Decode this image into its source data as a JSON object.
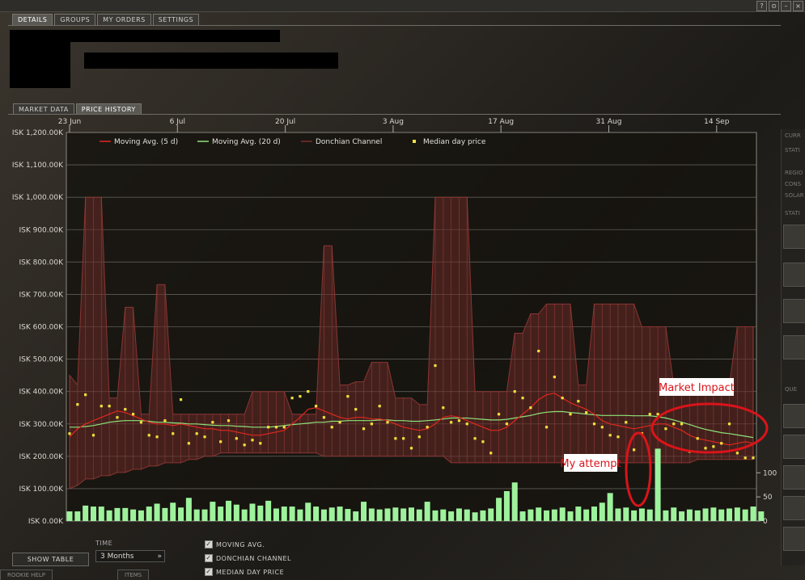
{
  "window": {
    "controls": [
      "?",
      "⊙",
      "–",
      "×"
    ]
  },
  "main_tabs": [
    {
      "label": "DETAILS",
      "active": true
    },
    {
      "label": "GROUPS",
      "active": false
    },
    {
      "label": "MY ORDERS",
      "active": false
    },
    {
      "label": "SETTINGS",
      "active": false
    }
  ],
  "sub_tabs": [
    {
      "label": "MARKET DATA",
      "active": false
    },
    {
      "label": "PRICE HISTORY",
      "active": true
    }
  ],
  "chart_data": {
    "type": "line",
    "x_ticks": [
      "23 Jun",
      "6 Jul",
      "20 Jul",
      "3 Aug",
      "17 Aug",
      "31 Aug",
      "14 Sep"
    ],
    "y_ticks": [
      "ISK 1,200.00K",
      "ISK 1,100.00K",
      "ISK 1,000.00K",
      "ISK 900.00K",
      "ISK 800.00K",
      "ISK 700.00K",
      "ISK 600.00K",
      "ISK 500.00K",
      "ISK 400.00K",
      "ISK 300.00K",
      "ISK 200.00K",
      "ISK 100.00K",
      "ISK 0.00K"
    ],
    "ylim": [
      0,
      1200
    ],
    "volume_ticks": [
      "100",
      "50",
      "0"
    ],
    "volume_lim": [
      0,
      150
    ],
    "legend": [
      {
        "label": "Moving Avg. (5 d)",
        "color": "#e0281f",
        "kind": "line"
      },
      {
        "label": "Moving Avg. (20 d)",
        "color": "#8ee37a",
        "kind": "line"
      },
      {
        "label": "Donchian Channel",
        "color": "#7a2c2a",
        "kind": "line"
      },
      {
        "label": "Median day price",
        "color": "#f2e23b",
        "kind": "point"
      }
    ],
    "series": [
      {
        "name": "Median day price",
        "values": [
          270,
          360,
          390,
          265,
          355,
          355,
          320,
          345,
          330,
          305,
          265,
          260,
          310,
          270,
          375,
          240,
          270,
          260,
          305,
          245,
          310,
          255,
          235,
          250,
          240,
          290,
          290,
          290,
          380,
          385,
          400,
          355,
          320,
          290,
          305,
          385,
          345,
          285,
          300,
          355,
          305,
          255,
          255,
          225,
          260,
          290,
          480,
          350,
          305,
          310,
          300,
          255,
          245,
          210,
          330,
          300,
          400,
          380,
          350,
          525,
          290,
          445,
          380,
          330,
          370,
          335,
          300,
          290,
          265,
          260,
          305,
          220,
          270,
          330,
          330,
          285,
          300,
          300,
          215,
          255,
          225,
          230,
          240,
          300,
          210,
          195,
          195
        ]
      },
      {
        "name": "Moving Avg. (5 d)",
        "values": [
          260,
          285,
          300,
          310,
          320,
          330,
          340,
          335,
          325,
          315,
          305,
          300,
          300,
          295,
          300,
          295,
          290,
          285,
          285,
          280,
          280,
          275,
          270,
          265,
          265,
          270,
          275,
          280,
          300,
          320,
          345,
          350,
          340,
          330,
          320,
          315,
          320,
          320,
          315,
          315,
          310,
          300,
          290,
          285,
          280,
          285,
          300,
          320,
          325,
          320,
          310,
          300,
          290,
          280,
          280,
          290,
          310,
          330,
          350,
          375,
          390,
          395,
          380,
          365,
          355,
          345,
          330,
          310,
          300,
          295,
          290,
          285,
          290,
          295,
          300,
          300,
          290,
          280,
          265,
          255,
          250,
          245,
          240,
          235,
          240,
          245,
          240
        ]
      },
      {
        "name": "Moving Avg. (20 d)",
        "values": [
          290,
          290,
          292,
          295,
          300,
          305,
          308,
          310,
          310,
          310,
          308,
          305,
          305,
          303,
          302,
          300,
          300,
          298,
          296,
          295,
          295,
          293,
          292,
          290,
          290,
          290,
          292,
          295,
          298,
          300,
          302,
          305,
          305,
          308,
          308,
          310,
          310,
          310,
          310,
          312,
          312,
          310,
          310,
          308,
          308,
          310,
          312,
          315,
          318,
          318,
          318,
          316,
          314,
          312,
          312,
          314,
          318,
          322,
          326,
          332,
          336,
          338,
          338,
          335,
          333,
          330,
          328,
          326,
          326,
          326,
          326,
          325,
          325,
          325,
          322,
          318,
          312,
          305,
          298,
          290,
          283,
          278,
          273,
          270,
          266,
          262,
          258
        ]
      },
      {
        "name": "Donchian Channel",
        "high": [
          450,
          420,
          1000,
          1000,
          1000,
          380,
          380,
          660,
          660,
          330,
          330,
          730,
          730,
          330,
          330,
          330,
          330,
          330,
          330,
          330,
          330,
          330,
          330,
          400,
          400,
          400,
          400,
          400,
          330,
          330,
          330,
          330,
          850,
          850,
          420,
          420,
          430,
          430,
          490,
          490,
          490,
          380,
          380,
          380,
          360,
          360,
          1000,
          1000,
          1000,
          1000,
          1000,
          400,
          400,
          400,
          400,
          400,
          580,
          580,
          640,
          640,
          670,
          670,
          670,
          670,
          420,
          420,
          670,
          670,
          670,
          670,
          670,
          670,
          600,
          600,
          600,
          600,
          420,
          420,
          420,
          420,
          420,
          420,
          420,
          420,
          600,
          600,
          600
        ],
        "low": [
          100,
          110,
          130,
          130,
          140,
          140,
          150,
          150,
          160,
          160,
          170,
          170,
          180,
          180,
          180,
          190,
          190,
          200,
          200,
          210,
          210,
          210,
          210,
          210,
          210,
          210,
          210,
          210,
          210,
          210,
          210,
          210,
          200,
          200,
          200,
          200,
          200,
          200,
          200,
          200,
          200,
          200,
          200,
          200,
          200,
          200,
          200,
          200,
          180,
          180,
          180,
          180,
          180,
          180,
          180,
          180,
          180,
          180,
          180,
          180,
          180,
          180,
          180,
          180,
          180,
          180,
          180,
          180,
          180,
          180,
          180,
          180,
          180,
          180,
          180,
          180,
          180,
          180,
          180,
          190,
          190,
          190,
          190,
          190,
          190,
          190,
          190
        ]
      },
      {
        "name": "Volume",
        "values": [
          20,
          20,
          32,
          30,
          30,
          22,
          27,
          27,
          24,
          22,
          30,
          36,
          27,
          38,
          28,
          48,
          24,
          24,
          40,
          30,
          42,
          34,
          24,
          36,
          32,
          42,
          26,
          30,
          30,
          24,
          38,
          30,
          24,
          28,
          30,
          25,
          20,
          40,
          26,
          24,
          26,
          28,
          26,
          28,
          24,
          40,
          22,
          24,
          20,
          26,
          24,
          18,
          22,
          26,
          48,
          62,
          80,
          20,
          24,
          28,
          22,
          24,
          28,
          20,
          30,
          24,
          30,
          38,
          58,
          26,
          28,
          22,
          26,
          24,
          150,
          22,
          28,
          20,
          24,
          22,
          26,
          28,
          24,
          26,
          28,
          24,
          30,
          20
        ]
      }
    ]
  },
  "annotations": {
    "market_impact": "Market Impact",
    "my_attempt": "My attempt",
    "circle_color": "#d9141a"
  },
  "controls": {
    "show_table": "SHOW TABLE",
    "time_label": "TIME",
    "time_value": "3 Months",
    "checkboxes": [
      {
        "label": "MOVING AVG.",
        "checked": true
      },
      {
        "label": "DONCHIAN CHANNEL",
        "checked": true
      },
      {
        "label": "MEDIAN DAY PRICE",
        "checked": true
      }
    ]
  },
  "footer_tabs": [
    "ROOKIE HELP",
    "ITEMS"
  ],
  "right_panel": [
    "CURR",
    "STATI",
    "REGIO",
    "CONS",
    "SOLAR",
    "STATI",
    "QUE"
  ]
}
